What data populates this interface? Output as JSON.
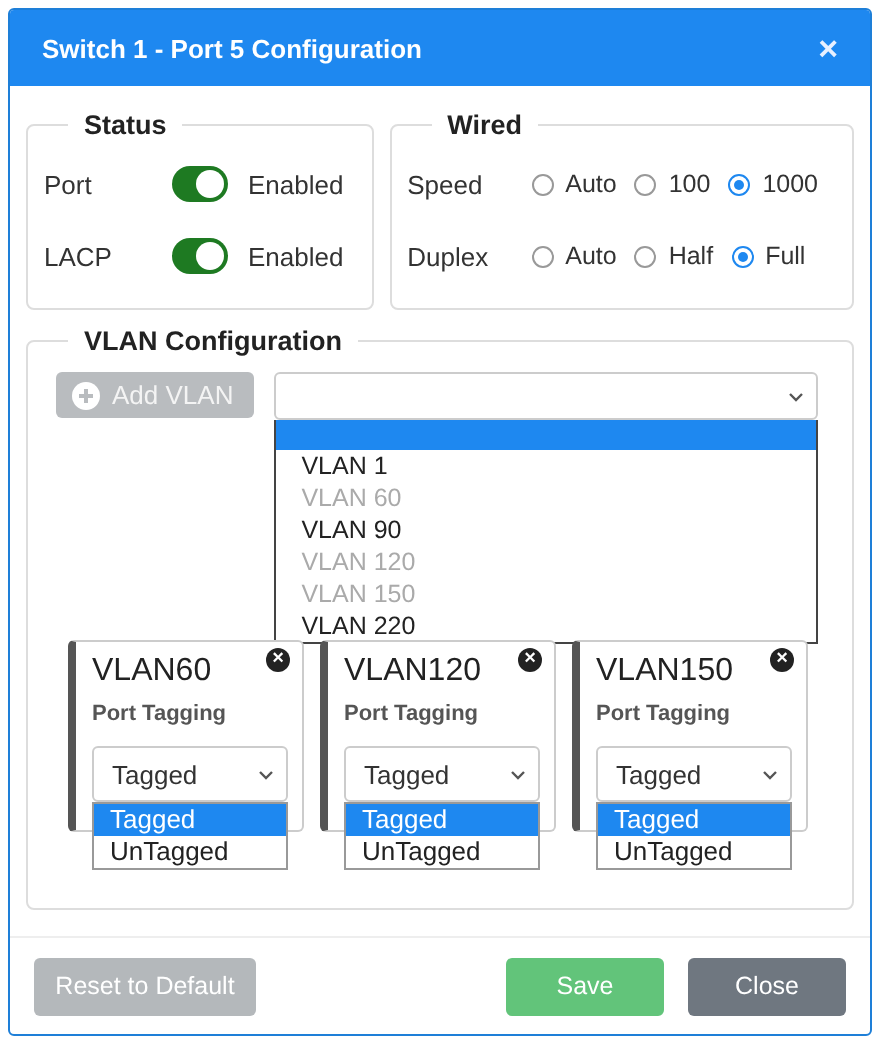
{
  "window": {
    "title": "Switch 1 - Port 5 Configuration",
    "close": "×"
  },
  "status": {
    "title": "Status",
    "rows": [
      {
        "label": "Port",
        "on": true,
        "text": "Enabled"
      },
      {
        "label": "LACP",
        "on": true,
        "text": "Enabled"
      }
    ]
  },
  "wired": {
    "title": "Wired",
    "rows": [
      {
        "label": "Speed",
        "options": [
          {
            "label": "Auto",
            "selected": false
          },
          {
            "label": "100",
            "selected": false
          },
          {
            "label": "1000",
            "selected": true
          }
        ]
      },
      {
        "label": "Duplex",
        "options": [
          {
            "label": "Auto",
            "selected": false
          },
          {
            "label": "Half",
            "selected": false
          },
          {
            "label": "Full",
            "selected": true
          }
        ]
      }
    ]
  },
  "vlan": {
    "title": "VLAN Configuration",
    "add_button": {
      "label": "Add VLAN",
      "disabled": true
    },
    "select": {
      "expanded": true,
      "blank_highlighted": true,
      "options": [
        {
          "label": "VLAN 1",
          "disabled": false
        },
        {
          "label": "VLAN 60",
          "disabled": true
        },
        {
          "label": "VLAN 90",
          "disabled": false
        },
        {
          "label": "VLAN 120",
          "disabled": true
        },
        {
          "label": "VLAN 150",
          "disabled": true
        },
        {
          "label": "VLAN 220",
          "disabled": false
        }
      ]
    },
    "cards": [
      {
        "name": "VLAN60",
        "close": "×",
        "field_label": "Port Tagging",
        "value": "Tagged",
        "expanded": true,
        "options": [
          {
            "label": "Tagged",
            "selected": true
          },
          {
            "label": "UnTagged",
            "selected": false
          }
        ]
      },
      {
        "name": "VLAN120",
        "close": "×",
        "field_label": "Port Tagging",
        "value": "Tagged",
        "expanded": true,
        "options": [
          {
            "label": "Tagged",
            "selected": true
          },
          {
            "label": "UnTagged",
            "selected": false
          }
        ]
      },
      {
        "name": "VLAN150",
        "close": "×",
        "field_label": "Port Tagging",
        "value": "Tagged",
        "expanded": true,
        "options": [
          {
            "label": "Tagged",
            "selected": true
          },
          {
            "label": "UnTagged",
            "selected": false
          }
        ]
      }
    ]
  },
  "footer": {
    "buttons": [
      {
        "label": "Reset to Default",
        "kind": "reset"
      },
      {
        "label": "Save",
        "kind": "save"
      },
      {
        "label": "Close",
        "kind": "close"
      }
    ]
  }
}
